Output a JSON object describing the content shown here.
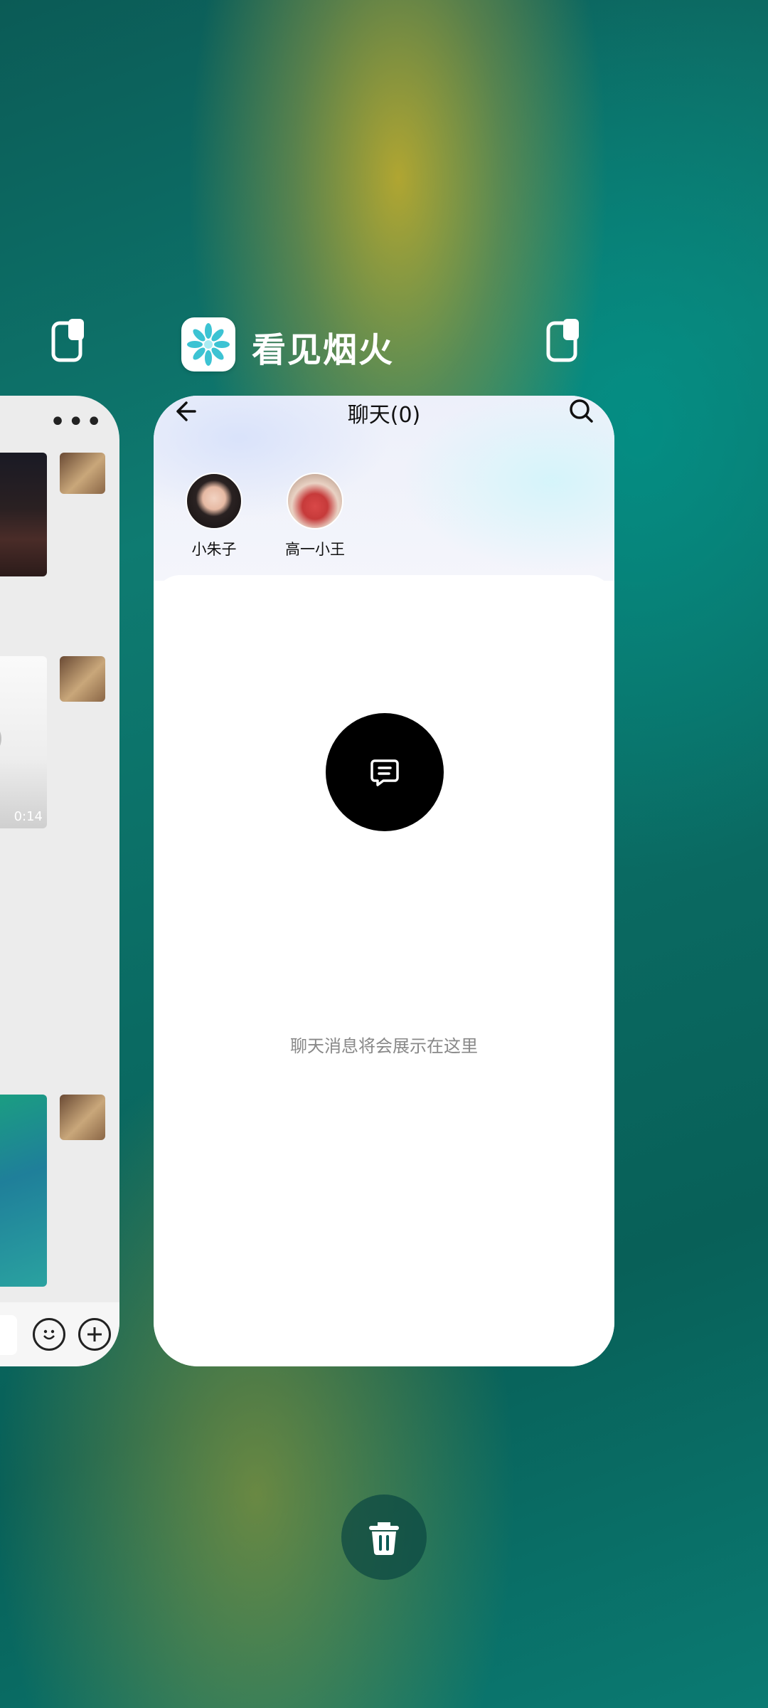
{
  "app": {
    "name": "看见烟火",
    "icon": "snowflake-app-icon",
    "accent_color": "#2bb8c7"
  },
  "left_card": {
    "menu_icon": "more-dots-icon",
    "video_duration": "0:14",
    "input_icons": [
      "emoji-icon",
      "plus-circle-icon"
    ]
  },
  "chat": {
    "title": "聊天(0)",
    "back_icon": "arrow-left-icon",
    "search_icon": "search-icon",
    "contacts": [
      {
        "name": "小朱子"
      },
      {
        "name": "高一小王"
      }
    ],
    "empty_icon": "chat-bubble-icon",
    "empty_text": "聊天消息将会展示在这里"
  },
  "controls": {
    "trash_icon": "trash-icon",
    "pin_icon": "window-pin-icon"
  }
}
